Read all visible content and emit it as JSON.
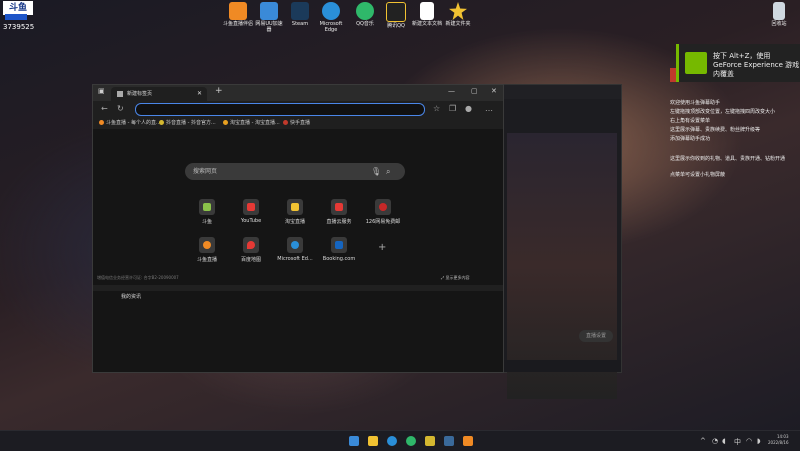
{
  "widget": {
    "logo": "斗鱼",
    "number": "3739525"
  },
  "desktop_icons": [
    {
      "label": "斗鱼直播伴侣",
      "color": "#f08a24"
    },
    {
      "label": "网易UU加速器",
      "color": "#3a8ad8"
    },
    {
      "label": "Steam",
      "color": "#1b3a5a"
    },
    {
      "label": "Microsoft Edge",
      "color": "#2a8fd8"
    },
    {
      "label": "QQ音乐",
      "color": "#2fb86a"
    },
    {
      "label": "腾讯QQ",
      "color": "#222222"
    },
    {
      "label": "新建文本文档",
      "color": "#ffffff"
    },
    {
      "label": "新建文件夹",
      "color": "#f1c232"
    }
  ],
  "recycle_bin": {
    "label": "回收站"
  },
  "toast": {
    "text": "按下 Alt+Z，使用 GeForce Experience 游戏内覆盖"
  },
  "side_text": [
    "欢迎使用斗鱼弹幕助手",
    "左键拖拽顶部改变位置，左键拖拽四周改变大小",
    "右上角有设置菜单",
    "这里展示弹幕、贵族续费、粉丝牌升级等",
    "添加弹幕助手成功",
    "这里展示你收到的礼物、道具、贵族开通、钻粉开通",
    "点菜单可设置小礼物屏蔽"
  ],
  "bg_window": {
    "button": "直播设置"
  },
  "browser": {
    "tab_title": "新建标签页",
    "window_controls": {
      "minimize": "—",
      "maximize": "▢",
      "close": "✕"
    },
    "bookmarks": [
      {
        "label": "斗鱼直播 - 每个人的直...",
        "color": "#f08a24"
      },
      {
        "label": "抖音直播 - 抖音官方...",
        "color": "#d4b830"
      },
      {
        "label": "淘宝直播 - 淘宝直播...",
        "color": "#e8a020"
      },
      {
        "label": "快手直播",
        "color": "#c0392b"
      }
    ],
    "search_placeholder": "搜索网页",
    "tiles": [
      {
        "label": "斗鱼",
        "color": "#8bc34a"
      },
      {
        "label": "YouTube",
        "color": "#e53935"
      },
      {
        "label": "淘宝直播",
        "color": "#f1c232"
      },
      {
        "label": "直播云服务",
        "color": "#e53935"
      },
      {
        "label": "126网易免费邮",
        "color": "#c62828"
      },
      {
        "label": "斗鱼直播",
        "color": "#f08a24"
      },
      {
        "label": "百度地图",
        "color": "#e53935"
      },
      {
        "label": "Microsoft Ed...",
        "color": "#2a8fd8"
      },
      {
        "label": "Booking.com",
        "color": "#1565c0"
      }
    ],
    "footer_left": "增值电信业务经营许可证: 合字B2-20090007",
    "footer_right": "显示更多内容",
    "news_label": "我的资讯"
  },
  "taskbar": {
    "apps": [
      {
        "name": "start",
        "color": "#3a8ad8"
      },
      {
        "name": "explorer",
        "color": "#f1c232"
      },
      {
        "name": "edge",
        "color": "#2a8fd8"
      },
      {
        "name": "edge-dev",
        "color": "#2fb86a"
      },
      {
        "name": "qq-music",
        "color": "#d4b830"
      },
      {
        "name": "steam",
        "color": "#3a6a9a"
      },
      {
        "name": "douyu",
        "color": "#f08a24"
      }
    ],
    "tray_lang": "中",
    "time": "14:03",
    "date": "2022/8/16"
  }
}
